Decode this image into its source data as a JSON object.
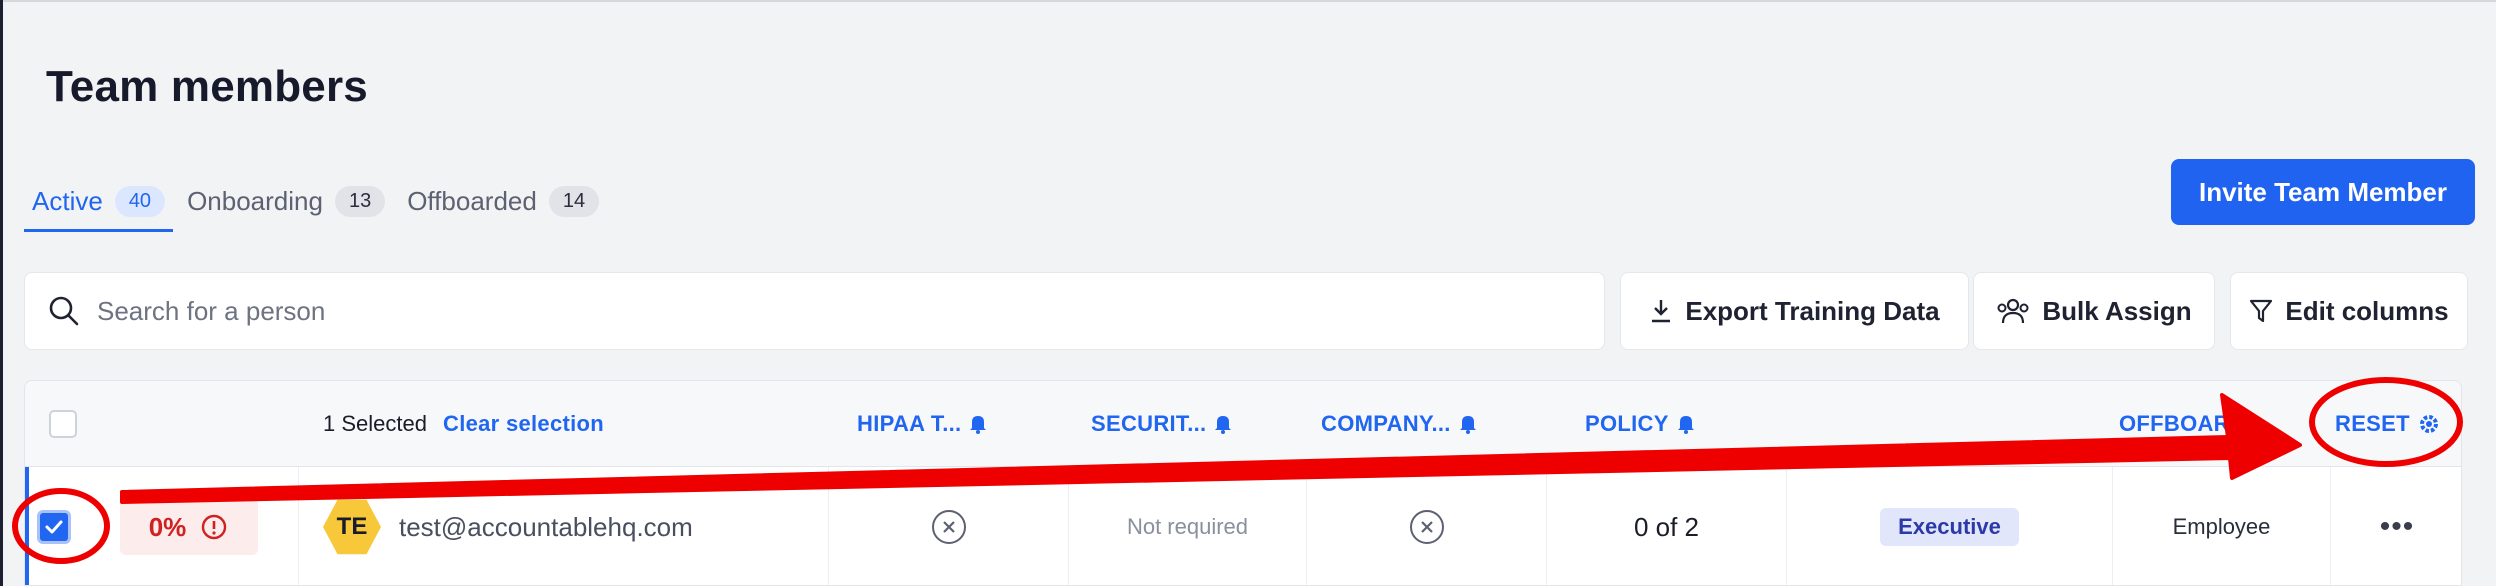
{
  "page": {
    "title": "Team members"
  },
  "tabs": [
    {
      "label": "Active",
      "count": "40"
    },
    {
      "label": "Onboarding",
      "count": "13"
    },
    {
      "label": "Offboarded",
      "count": "14"
    }
  ],
  "actions": {
    "invite_label": "Invite Team Member",
    "export_label": "Export Training Data",
    "bulk_assign_label": "Bulk Assign",
    "edit_columns_label": "Edit columns"
  },
  "search": {
    "placeholder": "Search for a person",
    "value": ""
  },
  "table": {
    "selection_text": "1 Selected",
    "clear_selection": "Clear selection",
    "columns": [
      "HIPAA T...",
      "SECURIT...",
      "COMPANY...",
      "POLICY",
      "OFFBOARD",
      "RESET"
    ],
    "row": {
      "score": "0%",
      "avatar_initials": "TE",
      "email": "test@accountablehq.com",
      "hipaa": "x",
      "security": "Not required",
      "company": "x",
      "policy": "0 of 2",
      "role": "Executive",
      "type": "Employee",
      "menu": "•••"
    }
  },
  "colors": {
    "accent": "#2166f0",
    "annotation": "#ee0000",
    "danger_bg": "#fdecec",
    "avatar": "#f7c83a"
  },
  "icons": [
    "search-icon",
    "download-icon",
    "users-icon",
    "filter-icon",
    "bell-icon",
    "gear-icon",
    "alert-icon",
    "check-icon",
    "x-circle-icon"
  ]
}
